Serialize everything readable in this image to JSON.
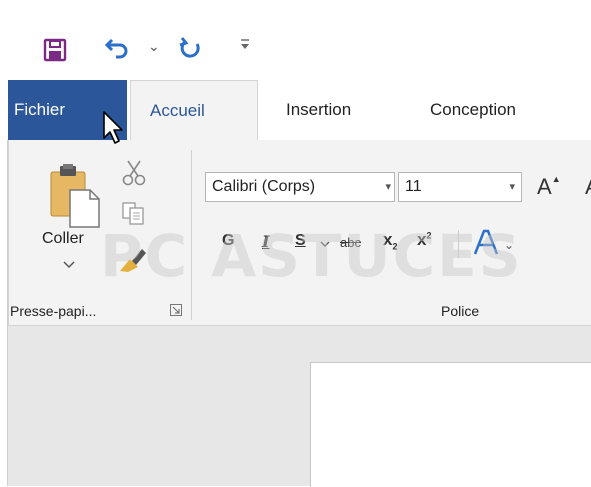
{
  "quick_access": {
    "save_icon": "save-icon",
    "undo_icon": "undo-icon",
    "undo_dropdown": "⌄",
    "redo_icon": "redo-icon",
    "customize": "⩡"
  },
  "tabs": [
    {
      "label": "Fichier"
    },
    {
      "label": "Accueil"
    },
    {
      "label": "Insertion"
    },
    {
      "label": "Conception"
    }
  ],
  "clipboard": {
    "paste_label": "Coller",
    "group_label": "Presse-papi..."
  },
  "font": {
    "font_name": "Calibri (Corps)",
    "font_size": "11",
    "grow_font": "A",
    "bold": "G",
    "italic": "I",
    "underline": "S",
    "strike": "abc",
    "subscript": "x",
    "sub_mark": "2",
    "superscript": "x",
    "sup_mark": "2",
    "group_label": "Police"
  },
  "watermark": "PC ASTUCES",
  "colors": {
    "file_tab": "#2b579a",
    "accent": "#2b579a",
    "ribbon_bg": "#f3f3f3",
    "save_purple": "#7b2a85",
    "undo_blue": "#2b6fc9"
  }
}
